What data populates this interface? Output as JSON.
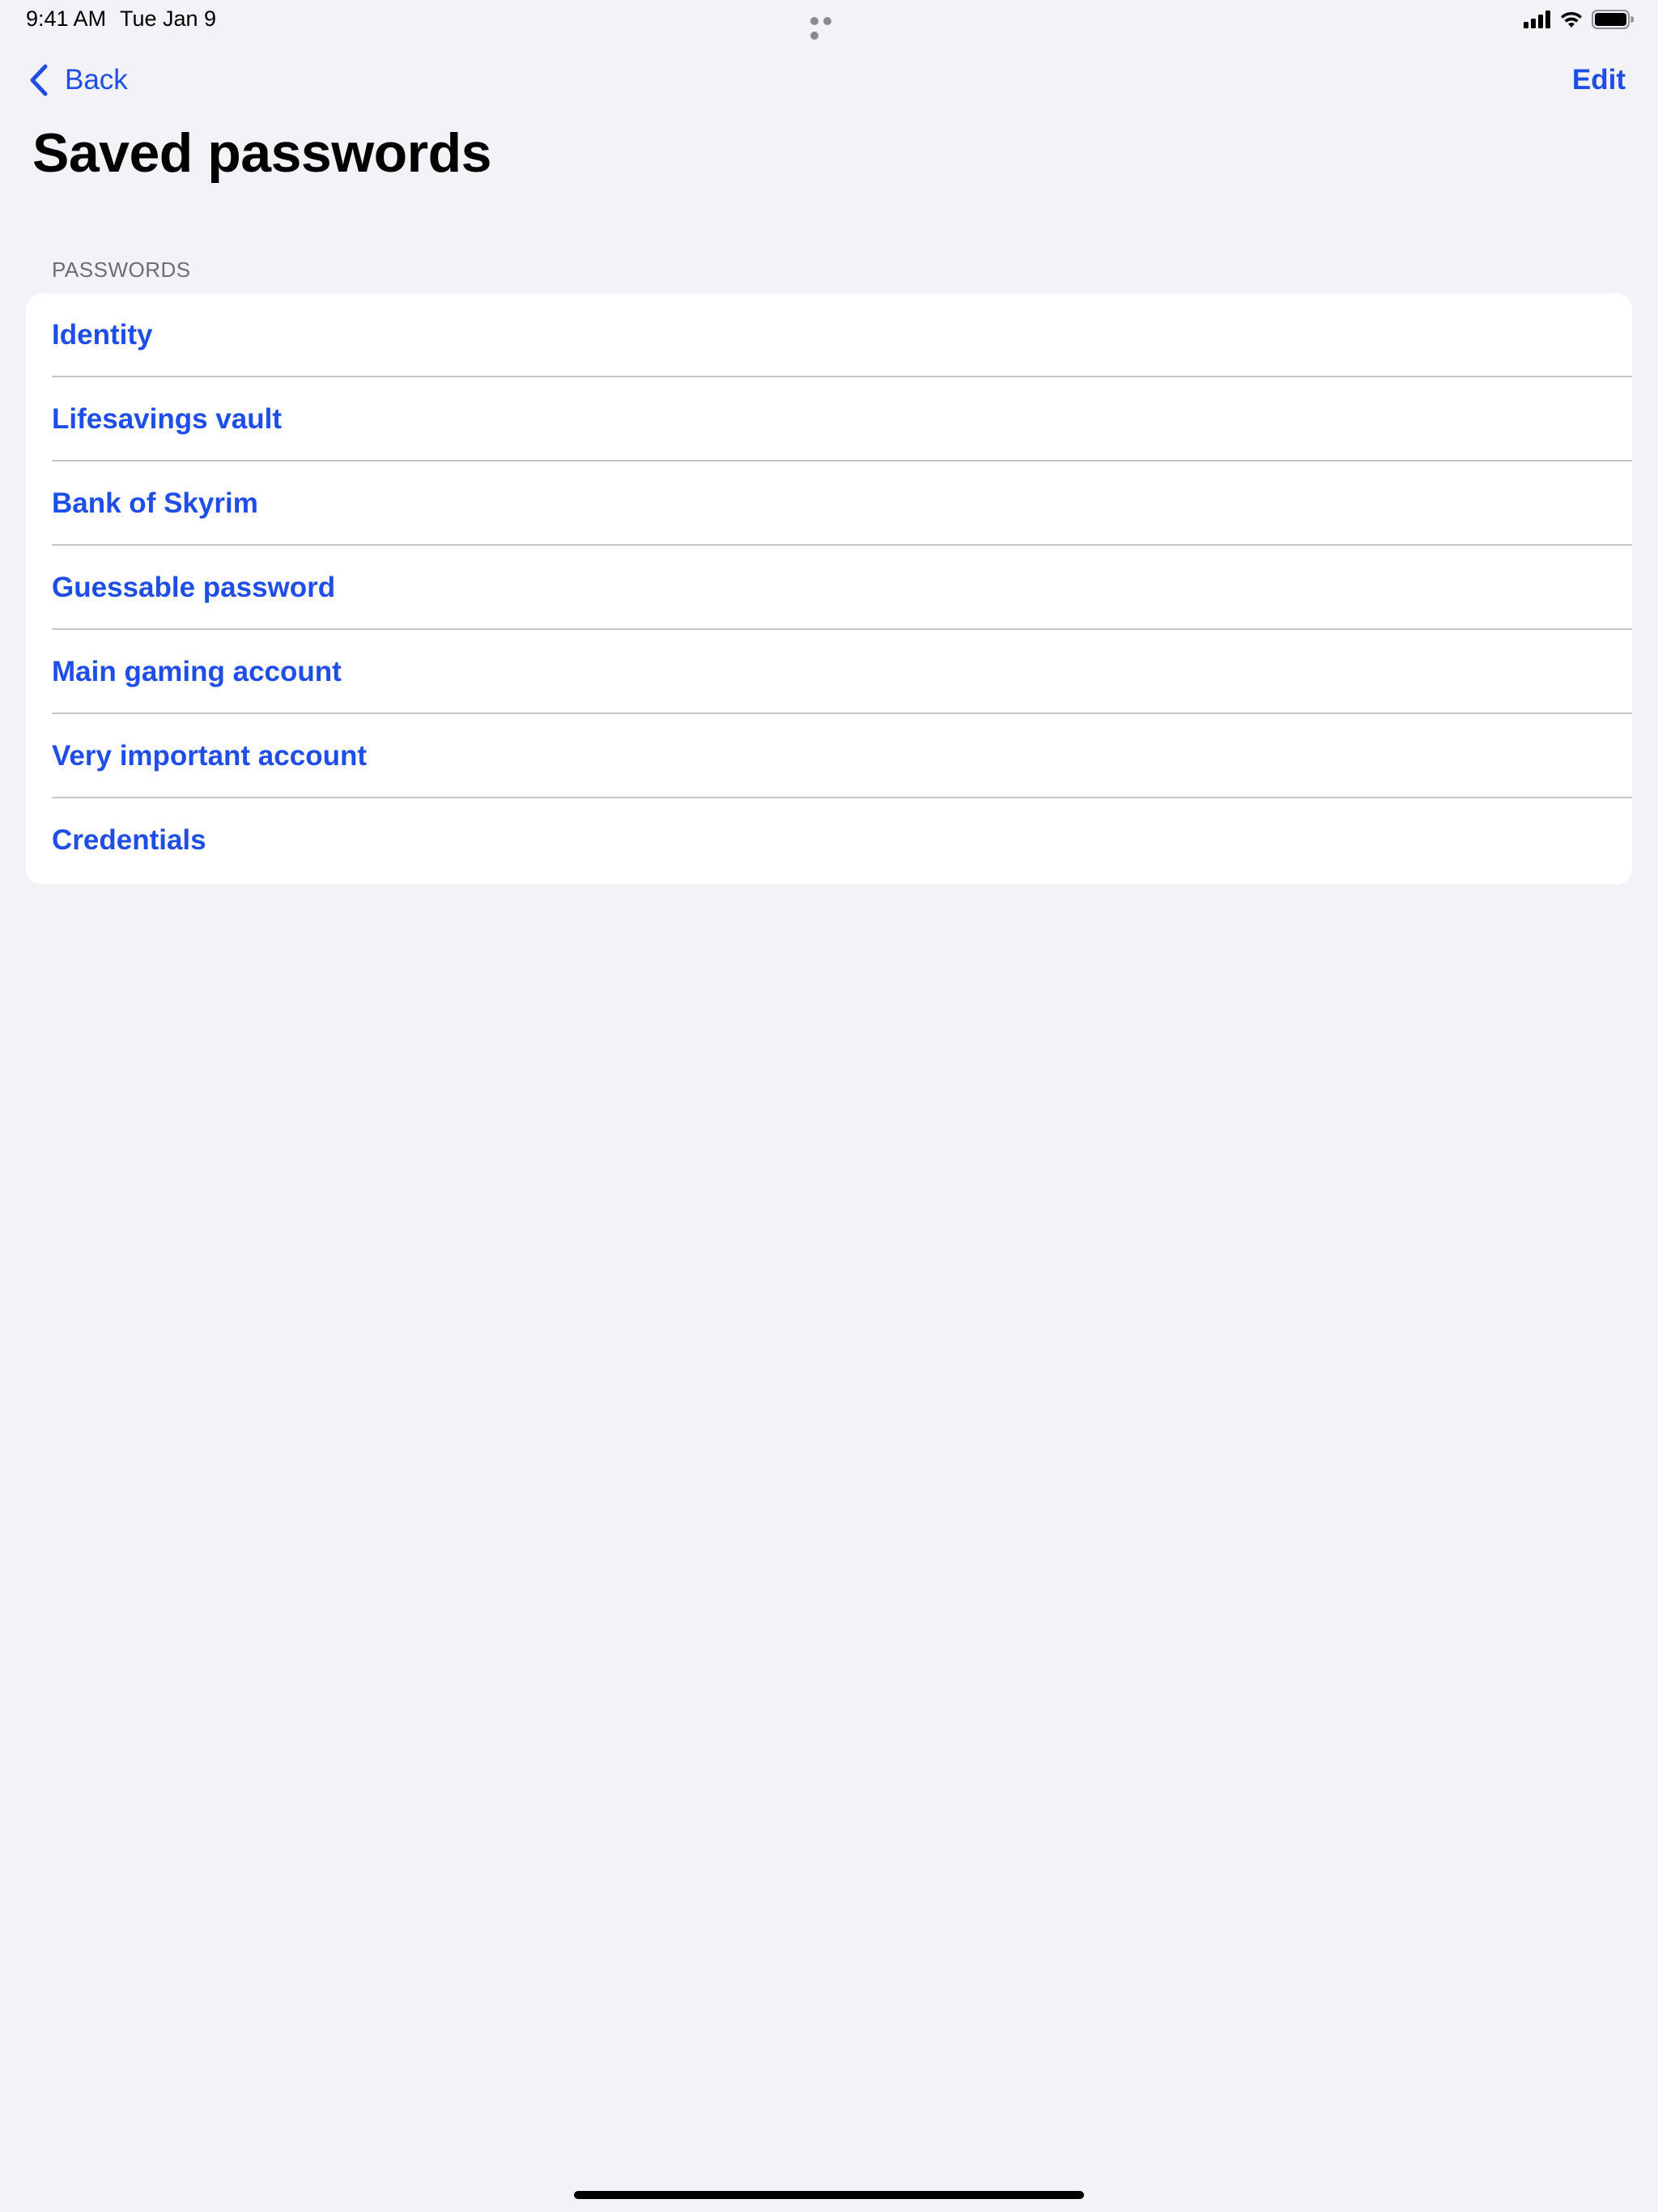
{
  "status_bar": {
    "time": "9:41 AM",
    "date": "Tue Jan 9",
    "icons": [
      "cellular-signal-icon",
      "wifi-icon",
      "battery-icon"
    ]
  },
  "nav": {
    "back_label": "Back",
    "edit_label": "Edit"
  },
  "page": {
    "title": "Saved passwords"
  },
  "section": {
    "header": "PASSWORDS",
    "items": [
      {
        "label": "Identity"
      },
      {
        "label": "Lifesavings vault"
      },
      {
        "label": "Bank of Skyrim"
      },
      {
        "label": "Guessable password"
      },
      {
        "label": "Main gaming account"
      },
      {
        "label": "Very important account"
      },
      {
        "label": "Credentials"
      }
    ]
  },
  "colors": {
    "accent": "#1f4ee6",
    "background": "#f2f2f7",
    "card": "#ffffff",
    "separator": "#c6c6c8",
    "section_header": "#6d6d72"
  }
}
